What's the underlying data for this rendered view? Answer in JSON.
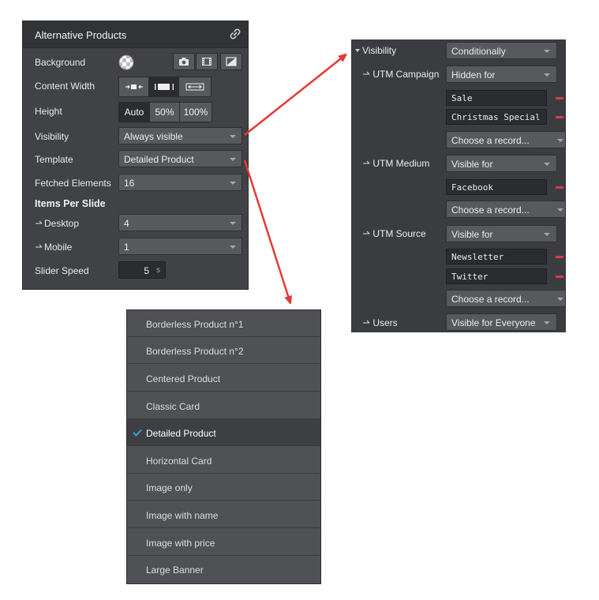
{
  "panel": {
    "title": "Alternative Products",
    "rows": {
      "background": {
        "label": "Background"
      },
      "content_width": {
        "label": "Content Width"
      },
      "height": {
        "label": "Height",
        "options": [
          "Auto",
          "50%",
          "100%"
        ],
        "selected": "Auto"
      },
      "visibility": {
        "label": "Visibility",
        "value": "Always visible"
      },
      "template": {
        "label": "Template",
        "value": "Detailed Product"
      },
      "fetched": {
        "label": "Fetched Elements",
        "value": "16"
      },
      "items_per_slide": {
        "label": "Items Per Slide"
      },
      "desktop": {
        "label": "Desktop",
        "value": "4"
      },
      "mobile": {
        "label": "Mobile",
        "value": "1"
      },
      "slider_speed": {
        "label": "Slider Speed",
        "value": "5",
        "unit": "s"
      }
    }
  },
  "visibility_panel": {
    "visibility": {
      "label": "Visibility",
      "value": "Conditionally"
    },
    "utm_campaign": {
      "label": "UTM Campaign",
      "mode": "Hidden for",
      "records": [
        "Sale",
        "Christmas Special"
      ],
      "choose": "Choose a record..."
    },
    "utm_medium": {
      "label": "UTM Medium",
      "mode": "Visible for",
      "records": [
        "Facebook"
      ],
      "choose": "Choose a record..."
    },
    "utm_source": {
      "label": "UTM Source",
      "mode": "Visible for",
      "records": [
        "Newsletter",
        "Twitter"
      ],
      "choose": "Choose a record..."
    },
    "users": {
      "label": "Users",
      "mode": "Visible for Everyone"
    }
  },
  "template_dropdown": {
    "items": [
      "Borderless Product n°1",
      "Borderless Product n°2",
      "Centered Product",
      "Classic Card",
      "Detailed Product",
      "Horizontal Card",
      "Image only",
      "Image with name",
      "Image with price",
      "Large Banner"
    ],
    "selected_index": 4
  },
  "colors": {
    "panel_bg": "#414245",
    "title_bg": "#323336",
    "control_bg": "#58595d",
    "active_bg": "#2b2c2f",
    "accent_check": "#2ea3d6",
    "remove_red": "#e0394b",
    "arrow_red": "#e53935"
  },
  "icons": [
    "link-icon",
    "checker-swatch-icon",
    "camera-icon",
    "film-icon",
    "gradient-icon",
    "chevron-down-icon",
    "check-icon",
    "remove-icon"
  ]
}
